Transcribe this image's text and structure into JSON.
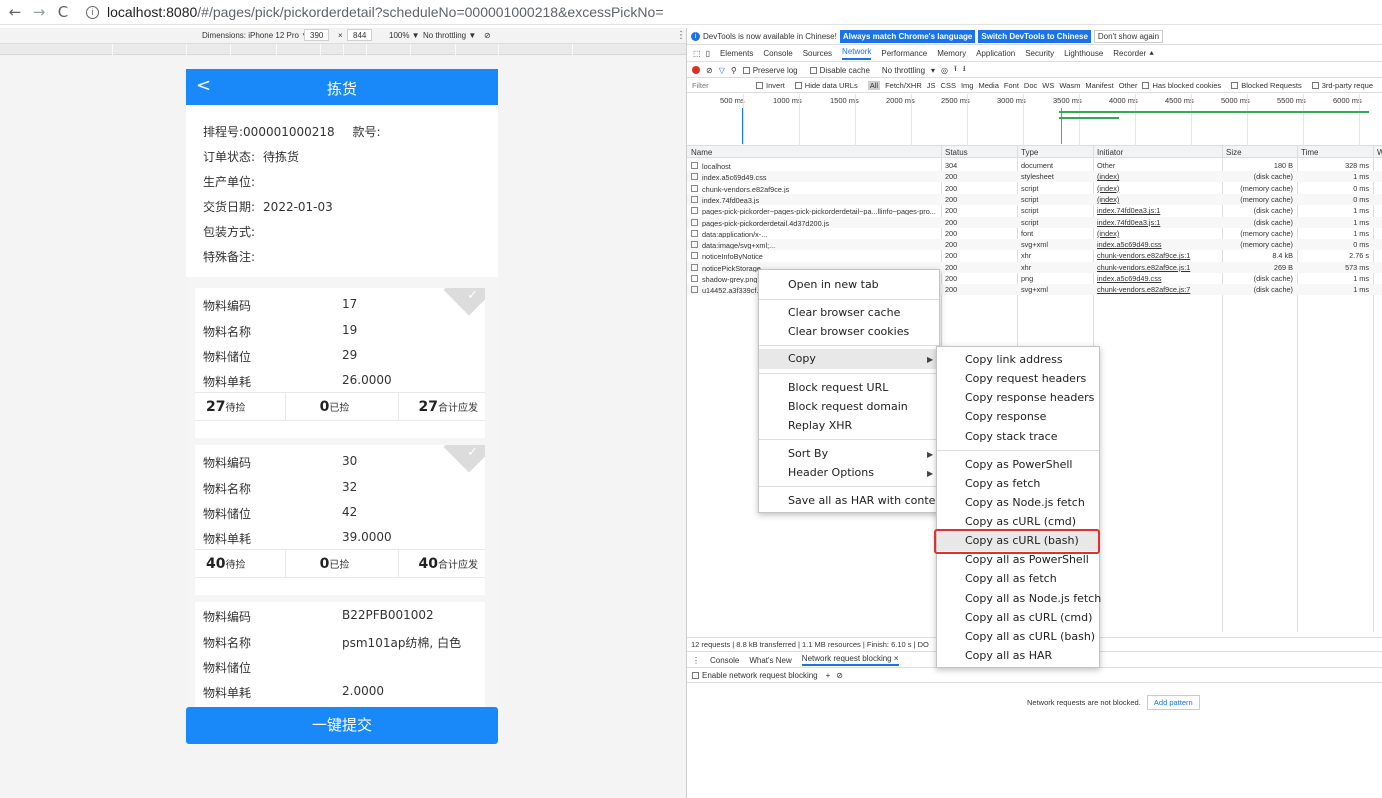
{
  "browser": {
    "url_host": "localhost:8080",
    "url_path": "/#/pages/pick/pickorderdetail?scheduleNo=000001000218&excessPickNo="
  },
  "device_toolbar": {
    "dimensions_label": "Dimensions: iPhone 12 Pro ▼",
    "width": "390",
    "times": "×",
    "height": "844",
    "zoom": "100% ▼",
    "throttle": "No throttling ▼",
    "rotate_icon": "⊘"
  },
  "phone": {
    "back": "<",
    "title": "拣货",
    "info": [
      {
        "label": "排程号:",
        "value": "000001000218",
        "extra_label": "款号:"
      },
      {
        "label": "订单状态:",
        "value": "待拣货"
      },
      {
        "label": "生产单位:",
        "value": ""
      },
      {
        "label": "交货日期:",
        "value": "2022-01-03"
      },
      {
        "label": "包装方式:",
        "value": ""
      },
      {
        "label": "特殊备注:",
        "value": ""
      }
    ],
    "cards": [
      {
        "rows": [
          {
            "label": "物料编码",
            "value": "17"
          },
          {
            "label": "物料名称",
            "value": "19"
          },
          {
            "label": "物料储位",
            "value": "29"
          },
          {
            "label": "物料单耗",
            "value": "26.0000"
          }
        ],
        "to_pick": "27",
        "to_pick_label": "待捡",
        "picked": "0",
        "picked_label": "已捡",
        "total": "27",
        "total_label": "合计应发"
      },
      {
        "rows": [
          {
            "label": "物料编码",
            "value": "30"
          },
          {
            "label": "物料名称",
            "value": "32"
          },
          {
            "label": "物料储位",
            "value": "42"
          },
          {
            "label": "物料单耗",
            "value": "39.0000"
          }
        ],
        "to_pick": "40",
        "to_pick_label": "待捡",
        "picked": "0",
        "picked_label": "已捡",
        "total": "40",
        "total_label": "合计应发"
      },
      {
        "rows": [
          {
            "label": "物料编码",
            "value": "B22PFB001002"
          },
          {
            "label": "物料名称",
            "value": "psm101ap纺棉, 白色"
          },
          {
            "label": "物料储位",
            "value": ""
          },
          {
            "label": "物料单耗",
            "value": "2.0000"
          }
        ]
      }
    ],
    "submit": "一键提交"
  },
  "devtools": {
    "notice": "DevTools is now available in Chinese!",
    "btn_match": "Always match Chrome's language",
    "btn_switch": "Switch DevTools to Chinese",
    "btn_dont": "Don't show again",
    "tabs": [
      "Elements",
      "Console",
      "Sources",
      "Network",
      "Performance",
      "Memory",
      "Application",
      "Security",
      "Lighthouse",
      "Recorder ⯅"
    ],
    "toolbar": {
      "preserve": "Preserve log",
      "disable_cache": "Disable cache",
      "throttle": "No throttling"
    },
    "filter": {
      "label": "Filter",
      "invert": "Invert",
      "hide_data": "Hide data URLs",
      "types": [
        "All",
        "Fetch/XHR",
        "JS",
        "CSS",
        "Img",
        "Media",
        "Font",
        "Doc",
        "WS",
        "Wasm",
        "Manifest",
        "Other"
      ],
      "blocked_cookies": "Has blocked cookies",
      "blocked_req": "Blocked Requests",
      "third_party": "3rd-party reque"
    },
    "timeline_ticks": [
      "500 ms",
      "1000 ms",
      "1500 ms",
      "2000 ms",
      "2500 ms",
      "3000 ms",
      "3500 ms",
      "4000 ms",
      "4500 ms",
      "5000 ms",
      "5500 ms",
      "6000 ms"
    ],
    "columns": [
      "Name",
      "Status",
      "Type",
      "Initiator",
      "Size",
      "Time",
      "W"
    ],
    "requests": [
      {
        "name": "localhost",
        "status": "304",
        "type": "document",
        "initiator": "Other",
        "size": "180 B",
        "time": "328 ms"
      },
      {
        "name": "index.a5c69d49.css",
        "status": "200",
        "type": "stylesheet",
        "initiator": "(index)",
        "size": "(disk cache)",
        "time": "1 ms"
      },
      {
        "name": "chunk-vendors.e82af9ce.js",
        "status": "200",
        "type": "script",
        "initiator": "(index)",
        "size": "(memory cache)",
        "time": "0 ms"
      },
      {
        "name": "index.74fd0ea3.js",
        "status": "200",
        "type": "script",
        "initiator": "(index)",
        "size": "(memory cache)",
        "time": "0 ms"
      },
      {
        "name": "pages-pick-pickorder~pages-pick-pickorderdetail~pa...llinfo~pages-pro...",
        "status": "200",
        "type": "script",
        "initiator": "index.74fd0ea3.js:1",
        "size": "(disk cache)",
        "time": "1 ms"
      },
      {
        "name": "pages-pick-pickorderdetail.4d37d200.js",
        "status": "200",
        "type": "script",
        "initiator": "index.74fd0ea3.js:1",
        "size": "(disk cache)",
        "time": "1 ms"
      },
      {
        "name": "data:application/x-...",
        "status": "200",
        "type": "font",
        "initiator": "(index)",
        "size": "(memory cache)",
        "time": "1 ms"
      },
      {
        "name": "data:image/svg+xml;...",
        "status": "200",
        "type": "svg+xml",
        "initiator": "index.a5c69d49.css",
        "size": "(memory cache)",
        "time": "0 ms"
      },
      {
        "name": "noticeInfoByNotice",
        "status": "200",
        "type": "xhr",
        "initiator": "chunk-vendors.e82af9ce.js:1",
        "size": "8.4 kB",
        "time": "2.76 s"
      },
      {
        "name": "noticePickStorage",
        "status": "200",
        "type": "xhr",
        "initiator": "chunk-vendors.e82af9ce.js:1",
        "size": "269 B",
        "time": "573 ms"
      },
      {
        "name": "shadow-grey.png",
        "status": "200",
        "type": "png",
        "initiator": "index.a5c69d49.css",
        "size": "(disk cache)",
        "time": "1 ms"
      },
      {
        "name": "u14452.a3f339cf.s",
        "status": "200",
        "type": "svg+xml",
        "initiator": "chunk-vendors.e82af9ce.js:7",
        "size": "(disk cache)",
        "time": "1 ms"
      }
    ],
    "status_bar": "12 requests | 8.8 kB transferred | 1.1 MB resources | Finish: 6.10 s | DO",
    "drawer_tabs": [
      "Console",
      "What's New",
      "Network request blocking ×"
    ],
    "enable_blocking": "Enable network request blocking",
    "not_blocked": "Network requests are not blocked.",
    "add_pattern": "Add pattern"
  },
  "context_menu": {
    "items": [
      "Open in new tab",
      "Clear browser cache",
      "Clear browser cookies",
      "Copy",
      "Block request URL",
      "Block request domain",
      "Replay XHR",
      "Sort By",
      "Header Options",
      "Save all as HAR with content"
    ]
  },
  "copy_submenu": {
    "items": [
      "Copy link address",
      "Copy request headers",
      "Copy response headers",
      "Copy response",
      "Copy stack trace",
      "Copy as PowerShell",
      "Copy as fetch",
      "Copy as Node.js fetch",
      "Copy as cURL (cmd)",
      "Copy as cURL (bash)",
      "Copy all as PowerShell",
      "Copy all as fetch",
      "Copy all as Node.js fetch",
      "Copy all as cURL (cmd)",
      "Copy all as cURL (bash)",
      "Copy all as HAR"
    ],
    "highlighted": "Copy as cURL (bash)"
  }
}
